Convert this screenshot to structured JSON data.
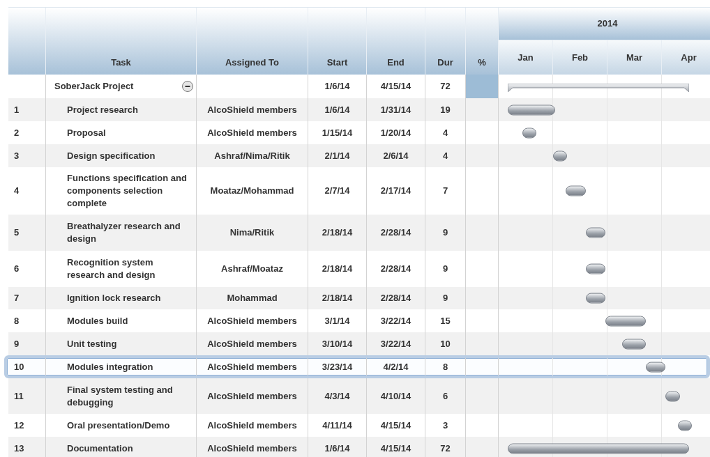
{
  "columns": [
    "",
    "Task",
    "Assigned To",
    "Start",
    "End",
    "Dur",
    "%"
  ],
  "timeline": {
    "year": "2014",
    "months": [
      "Jan",
      "Feb",
      "Mar",
      "Apr"
    ]
  },
  "rows": [
    {
      "kind": "summary",
      "id": "",
      "task": "SoberJack Project",
      "expanded": true,
      "assigned": "",
      "start": "1/6/14",
      "end": "4/15/14",
      "dur": "72",
      "selected": false
    },
    {
      "kind": "task",
      "id": "1",
      "task": "Project research",
      "assigned": "AlcoShield members",
      "start": "1/6/14",
      "end": "1/31/14",
      "dur": "19",
      "selected": false
    },
    {
      "kind": "task",
      "id": "2",
      "task": "Proposal",
      "assigned": "AlcoShield members",
      "start": "1/15/14",
      "end": "1/20/14",
      "dur": "4",
      "selected": false
    },
    {
      "kind": "task",
      "id": "3",
      "task": "Design specification",
      "assigned": "Ashraf/Nima/Ritik",
      "start": "2/1/14",
      "end": "2/6/14",
      "dur": "4",
      "selected": false
    },
    {
      "kind": "task",
      "id": "4",
      "task": "Functions specification and components selection complete",
      "assigned": "Moataz/Mohammad",
      "start": "2/7/14",
      "end": "2/17/14",
      "dur": "7",
      "selected": false
    },
    {
      "kind": "task",
      "id": "5",
      "task": "Breathalyzer research and design",
      "assigned": "Nima/Ritik",
      "start": "2/18/14",
      "end": "2/28/14",
      "dur": "9",
      "selected": false
    },
    {
      "kind": "task",
      "id": "6",
      "task": "Recognition system research and design",
      "assigned": "Ashraf/Moataz",
      "start": "2/18/14",
      "end": "2/28/14",
      "dur": "9",
      "selected": false
    },
    {
      "kind": "task",
      "id": "7",
      "task": "Ignition lock research",
      "assigned": "Mohammad",
      "start": "2/18/14",
      "end": "2/28/14",
      "dur": "9",
      "selected": false
    },
    {
      "kind": "task",
      "id": "8",
      "task": "Modules build",
      "assigned": "AlcoShield members",
      "start": "3/1/14",
      "end": "3/22/14",
      "dur": "15",
      "selected": false
    },
    {
      "kind": "task",
      "id": "9",
      "task": "Unit testing",
      "assigned": "AlcoShield members",
      "start": "3/10/14",
      "end": "3/22/14",
      "dur": "10",
      "selected": false
    },
    {
      "kind": "task",
      "id": "10",
      "task": "Modules integration",
      "assigned": "AlcoShield members",
      "start": "3/23/14",
      "end": "4/2/14",
      "dur": "8",
      "selected": true
    },
    {
      "kind": "task",
      "id": "11",
      "task": "Final system testing and debugging",
      "assigned": "AlcoShield members",
      "start": "4/3/14",
      "end": "4/10/14",
      "dur": "6",
      "selected": false
    },
    {
      "kind": "task",
      "id": "12",
      "task": "Oral presentation/Demo",
      "assigned": "AlcoShield members",
      "start": "4/11/14",
      "end": "4/15/14",
      "dur": "3",
      "selected": false
    },
    {
      "kind": "task",
      "id": "13",
      "task": "Documentation",
      "assigned": "AlcoShield members",
      "start": "1/6/14",
      "end": "4/15/14",
      "dur": "72",
      "selected": false
    }
  ]
}
